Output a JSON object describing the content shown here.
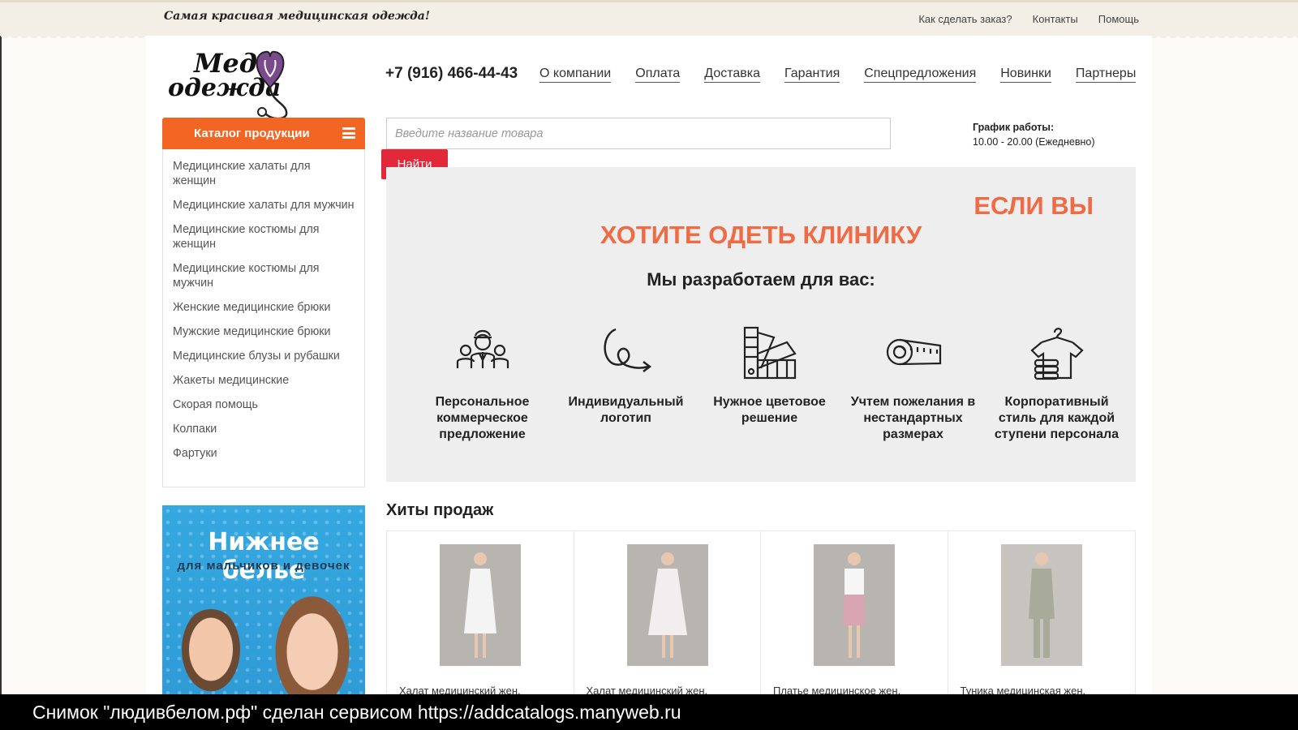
{
  "topbar": {
    "slogan": "Самая красивая медицинская одежда!",
    "links": [
      "Как сделать заказ?",
      "Контакты",
      "Помощь"
    ]
  },
  "logo": {
    "line1": "Мед",
    "line2": "одежда"
  },
  "header": {
    "phone": "+7 (916) 466-44-43",
    "nav": [
      "О компании",
      "Оплата",
      "Доставка",
      "Гарантия",
      "Спецпредложения",
      "Новинки",
      "Партнеры"
    ]
  },
  "catalog": {
    "title": "Каталог продукции",
    "items": [
      "Медицинские халаты для женщин",
      "Медицинские халаты для мужчин",
      "Медицинские костюмы для женщин",
      "Медицинские костюмы для мужчин",
      "Женские медицинские брюки",
      "Мужские медицинские брюки",
      "Медицинские блузы и рубашки",
      "Жакеты медицинские",
      "Скорая помощь",
      "Колпаки",
      "Фартуки"
    ]
  },
  "search": {
    "placeholder": "Введите название товара",
    "button": "Найти"
  },
  "hours": {
    "label": "График работы:",
    "value": "10.00 - 20.00 (Ежедневно)"
  },
  "promo": {
    "line1": "ЕСЛИ ВЫ",
    "line2": "ХОТИТЕ ОДЕТЬ КЛИНИКУ",
    "subtitle": "Мы разработаем для вас:",
    "features": [
      {
        "icon": "team-icon",
        "label": "Персональное коммерческое предложение"
      },
      {
        "icon": "logo-swirl-icon",
        "label": "Индивидуальный логотип"
      },
      {
        "icon": "color-palette-icon",
        "label": "Нужное цветовое решение"
      },
      {
        "icon": "measuring-tape-icon",
        "label": "Учтем пожелания в нестандартных размерах"
      },
      {
        "icon": "shirt-hanger-icon",
        "label": "Корпоративный стиль для каждой ступени персонала"
      }
    ]
  },
  "banner": {
    "title": "Нижнее белье",
    "subtitle": "для мальчиков и девочек"
  },
  "hits": {
    "title": "Хиты продаж",
    "products": [
      {
        "name": "Халат медицинский жен.",
        "color": "#f4f4f4"
      },
      {
        "name": "Халат медицинский жен.",
        "color": "#f2eef0"
      },
      {
        "name": "Платье медицинское жен.",
        "color": "#d9a5b3"
      },
      {
        "name": "Туника медицинская жен.",
        "color": "#a9ab9a"
      }
    ]
  },
  "caption": "Снимок \"людивбелом.рф\" сделан сервисом https://addcatalogs.manyweb.ru",
  "colors": {
    "accent": "#f26522",
    "button": "#e2293a",
    "promo_text": "#f06a44"
  }
}
